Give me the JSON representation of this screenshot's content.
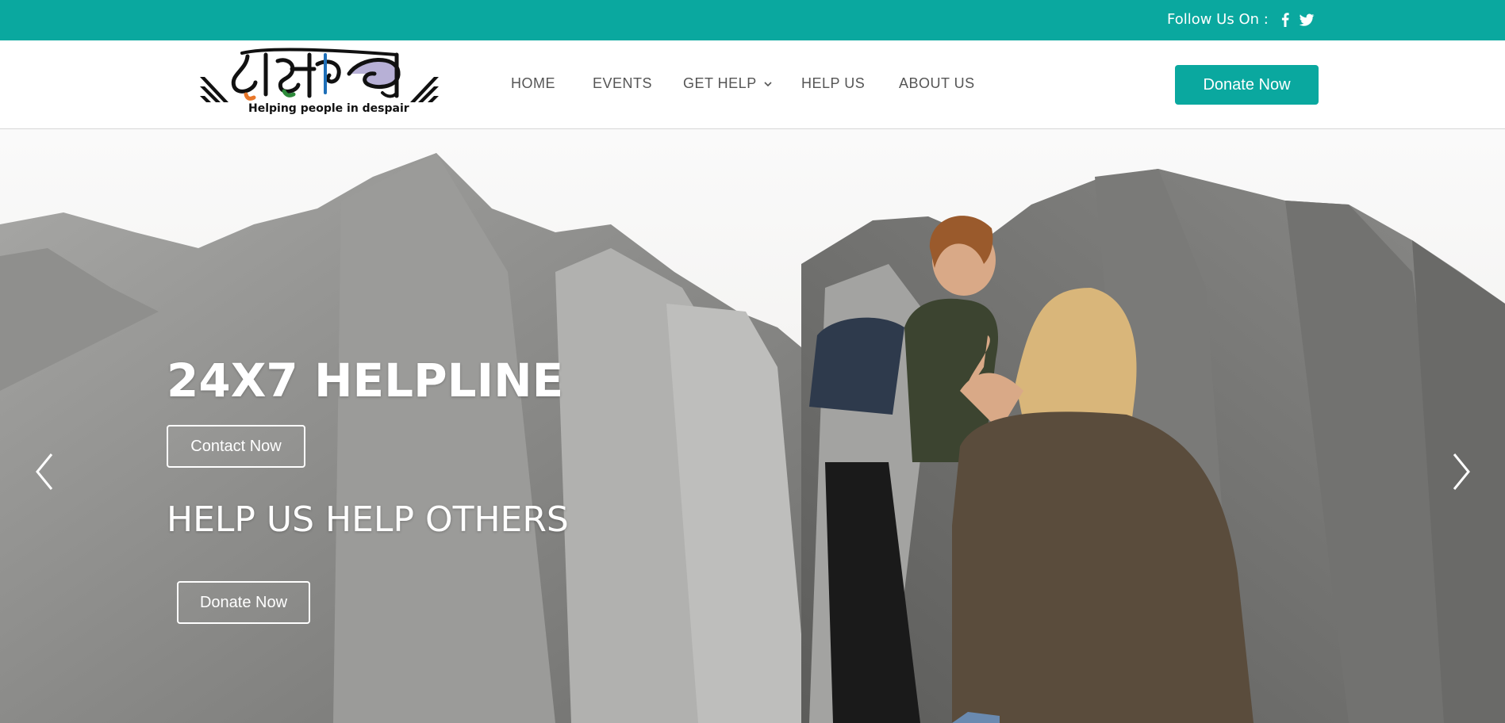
{
  "topbar": {
    "follow_text": "Follow Us On :",
    "social": [
      "facebook-icon",
      "twitter-icon"
    ],
    "color": "#0aa89f"
  },
  "header": {
    "logo": {
      "script_text": "आसरा",
      "tagline": "Helping people in despair"
    },
    "nav": [
      {
        "label": "HOME"
      },
      {
        "label": "EVENTS"
      },
      {
        "label": "GET HELP",
        "has_dropdown": true
      },
      {
        "label": "HELP US"
      },
      {
        "label": "ABOUT US"
      }
    ],
    "donate_label": "Donate Now"
  },
  "hero": {
    "title": "24X7 HELPLINE",
    "contact_label": "Contact Now",
    "subtitle": "HELP US HELP OTHERS",
    "donate_label": "Donate Now",
    "prev_icon": "chevron-left-icon",
    "next_icon": "chevron-right-icon"
  }
}
